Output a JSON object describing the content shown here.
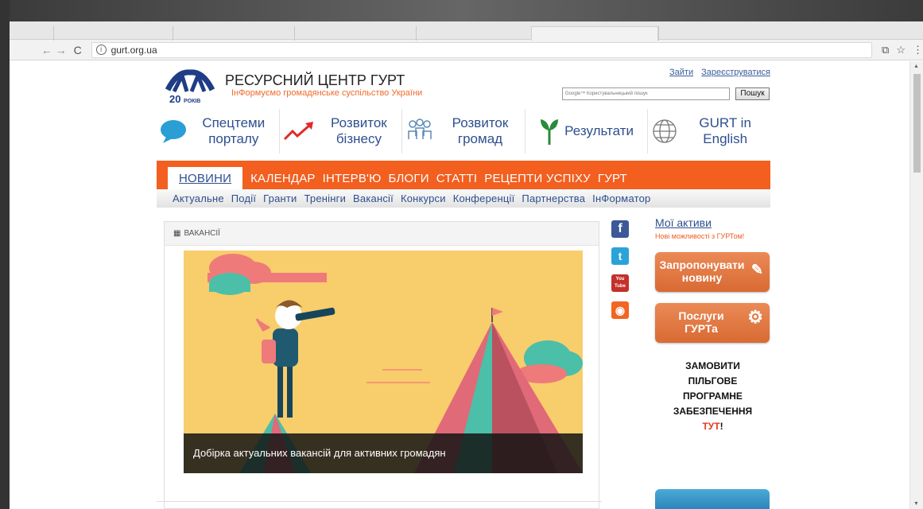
{
  "browser": {
    "url": "gurt.org.ua",
    "nav_back": "←",
    "nav_forward": "→",
    "nav_reload": "C",
    "info_glyph": "i",
    "translate_glyph": "⧉",
    "star_glyph": "☆",
    "menu_glyph": "⋮"
  },
  "header": {
    "logo_text": "20РОКІВ",
    "title": "РЕСУРСНИЙ ЦЕНТР ГУРТ",
    "slogan": "ІнФормуємо громадянське суспільство України",
    "login_link": "Зайти",
    "register_link": "Зареєструватися",
    "search_placeholder": "Google™ Користувальницький пошук",
    "search_button": "Пошук"
  },
  "sections": [
    {
      "label": "Спецтеми порталу",
      "icon": "speech-bubble-icon",
      "color": "#2b9ed6"
    },
    {
      "label": "Розвиток бізнесу",
      "icon": "growth-arrow-icon",
      "color": "#e02a2a"
    },
    {
      "label": "Розвиток громад",
      "icon": "people-network-icon",
      "color": "#5a8ab8"
    },
    {
      "label": "Результати",
      "icon": "sprout-icon",
      "color": "#2a8a3a"
    },
    {
      "label": "GURT in English",
      "icon": "globe-icon",
      "color": "#777777"
    }
  ],
  "main_nav": [
    "НОВИНИ",
    "КАЛЕНДАР",
    "ІНТЕРВ'Ю",
    "БЛОГИ",
    "СТАТТІ",
    "РЕЦЕПТИ УСПІХУ",
    "ГУРТ"
  ],
  "sub_nav": [
    "Актуальне",
    "Події",
    "Гранти",
    "Тренінги",
    "Вакансії",
    "Конкурси",
    "Конференції",
    "Партнерства",
    "ІнФорматор"
  ],
  "news": {
    "section_label": "ВАКАНСІЇ",
    "caption": "Добірка актуальних вакансій для активних громадян"
  },
  "social": [
    {
      "name": "facebook-icon",
      "glyph": "f",
      "color": "#3b5998"
    },
    {
      "name": "twitter-icon",
      "glyph": "t",
      "color": "#2aa3d8"
    },
    {
      "name": "youtube-icon",
      "glyph": "You Tube",
      "color": "#c4302b"
    },
    {
      "name": "rss-icon",
      "glyph": "◉",
      "color": "#f26522"
    }
  ],
  "sidebar": {
    "my_assets": "Мої активи",
    "my_assets_sub": "Нові можливості з ГУРТом!",
    "suggest_button": "Запропонувати новину",
    "services_button": "Послуги ГУРТа",
    "order_text": "ЗАМОВИТИ ПІЛЬГОВЕ ПРОГРАМНЕ ЗАБЕЗПЕЧЕННЯ",
    "order_link": "ТУТ",
    "order_exclaim": "!"
  },
  "colors": {
    "accent_orange": "#f25f1f",
    "link_blue": "#2e4f8f"
  }
}
